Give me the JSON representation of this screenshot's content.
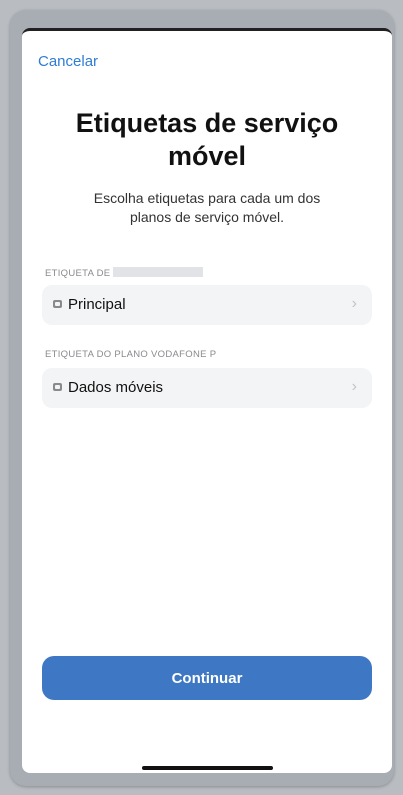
{
  "nav": {
    "cancel_label": "Cancelar"
  },
  "header": {
    "title": "Etiquetas de serviço móvel",
    "subtitle": "Escolha etiquetas para cada um dos planos de serviço móvel."
  },
  "sections": [
    {
      "label": "ETIQUETA DE",
      "value": "Principal"
    },
    {
      "label": "ETIQUETA DO PLANO VODAFONE P",
      "value": "Dados móveis"
    }
  ],
  "footer": {
    "continue_label": "Continuar"
  },
  "icons": {
    "row_badge": "sim-badge-icon",
    "row_chevron": "chevron-right-icon"
  },
  "colors": {
    "accent": "#2f7cd6",
    "button": "#3e78c4",
    "row_bg": "#f3f4f6"
  }
}
